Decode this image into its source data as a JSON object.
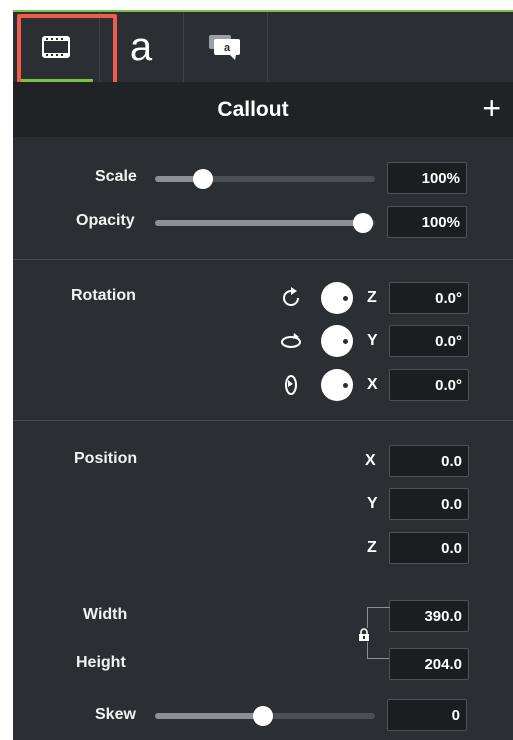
{
  "tabs": [
    {
      "name": "visual-properties",
      "icon": "film-icon"
    },
    {
      "name": "text-properties",
      "label": "a"
    },
    {
      "name": "annotation-properties",
      "icon": "callout-bubble-icon",
      "label": "a"
    }
  ],
  "header": {
    "title": "Callout",
    "add_label": "+"
  },
  "scale": {
    "label": "Scale",
    "value": "100%",
    "level_fraction": 0.2
  },
  "opacity": {
    "label": "Opacity",
    "value": "100%",
    "level_fraction": 1.0
  },
  "rotation": {
    "label": "Rotation",
    "z": {
      "axis": "Z",
      "value": "0.0°"
    },
    "y": {
      "axis": "Y",
      "value": "0.0°"
    },
    "x": {
      "axis": "X",
      "value": "0.0°"
    }
  },
  "position": {
    "label": "Position",
    "x": {
      "axis": "X",
      "value": "0.0"
    },
    "y": {
      "axis": "Y",
      "value": "0.0"
    },
    "z": {
      "axis": "Z",
      "value": "0.0"
    }
  },
  "size": {
    "width_label": "Width",
    "width_value": "390.0",
    "height_label": "Height",
    "height_value": "204.0",
    "lock_icon": "lock-icon"
  },
  "skew": {
    "label": "Skew",
    "value": "0",
    "level_fraction": 0.5
  },
  "colors": {
    "accent": "#7ac143",
    "highlight": "#ef5b4c",
    "panel": "#2b2f33"
  }
}
